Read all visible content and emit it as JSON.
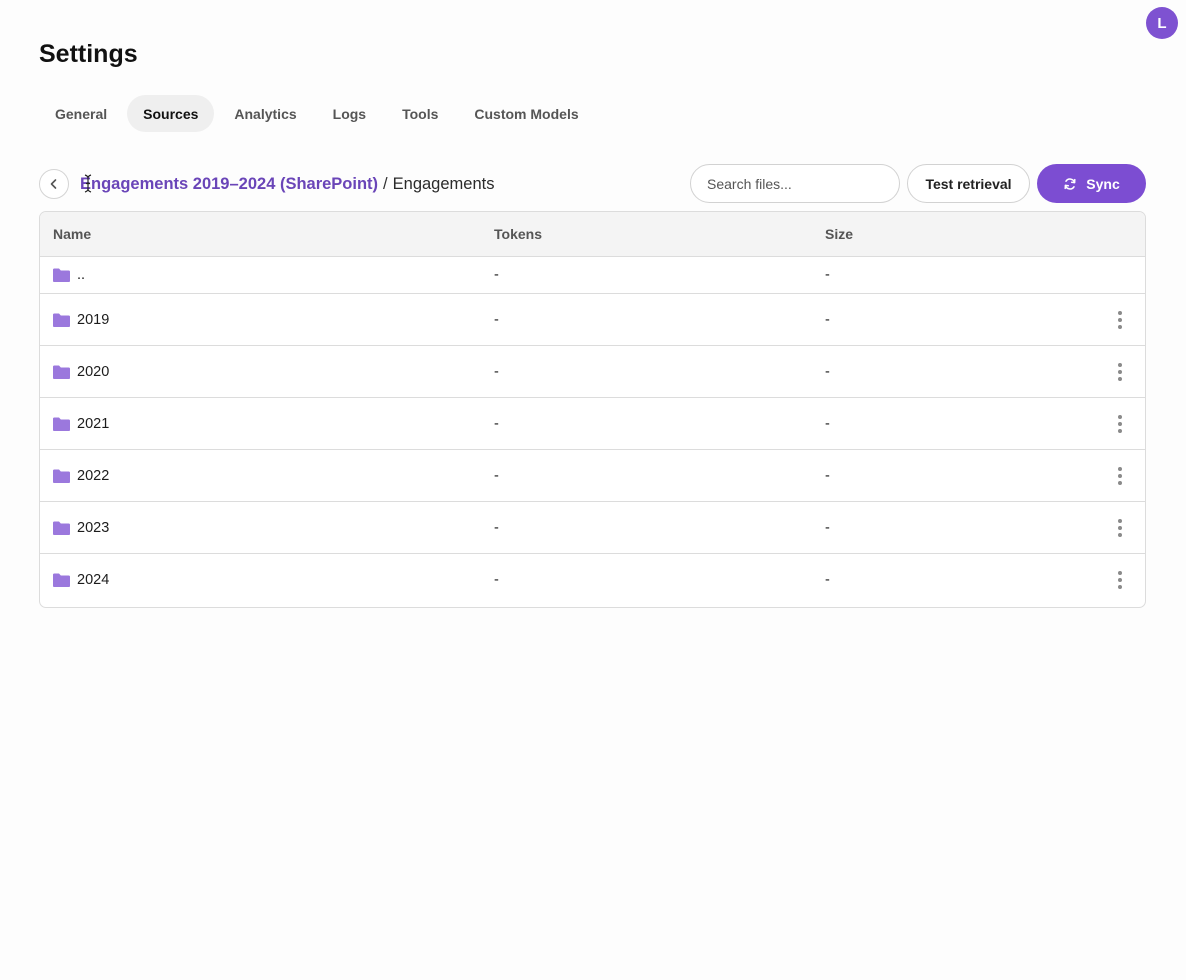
{
  "user": {
    "avatar_initial": "L"
  },
  "page": {
    "title": "Settings"
  },
  "tabs": [
    {
      "label": "General",
      "active": false
    },
    {
      "label": "Sources",
      "active": true
    },
    {
      "label": "Analytics",
      "active": false
    },
    {
      "label": "Logs",
      "active": false
    },
    {
      "label": "Tools",
      "active": false
    },
    {
      "label": "Custom Models",
      "active": false
    }
  ],
  "breadcrumb": {
    "source": "Engagements 2019–2024 (SharePoint)",
    "separator": "/",
    "current": "Engagements"
  },
  "toolbar": {
    "search_placeholder": "Search files...",
    "test_label": "Test retrieval",
    "sync_label": "Sync"
  },
  "table": {
    "columns": {
      "name": "Name",
      "tokens": "Tokens",
      "size": "Size"
    },
    "rows": [
      {
        "name": "..",
        "tokens": "-",
        "size": "-"
      },
      {
        "name": "2019",
        "tokens": "-",
        "size": "-"
      },
      {
        "name": "2020",
        "tokens": "-",
        "size": "-"
      },
      {
        "name": "2021",
        "tokens": "-",
        "size": "-"
      },
      {
        "name": "2022",
        "tokens": "-",
        "size": "-"
      },
      {
        "name": "2023",
        "tokens": "-",
        "size": "-"
      },
      {
        "name": "2024",
        "tokens": "-",
        "size": "-"
      }
    ]
  },
  "colors": {
    "accent": "#7c4dd2",
    "folder": "#9b78dd",
    "breadcrumb_link": "#6a45b8"
  },
  "icons": {
    "back": "chevron-left-icon",
    "sync": "refresh-icon",
    "folder": "folder-icon",
    "row_menu": "more-vertical-icon",
    "cursor": "text-cursor-icon"
  }
}
